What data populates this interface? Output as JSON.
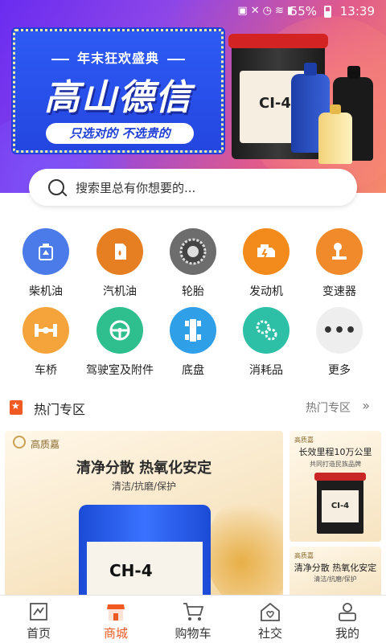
{
  "status_bar": {
    "battery_text": "55%",
    "time": "13:39"
  },
  "banner": {
    "subtitle": "年末狂欢盛典",
    "title": "高山德信",
    "tagline": "只选对的 不选贵的",
    "product_label": "CI-4"
  },
  "search": {
    "placeholder": "搜索里总有你想要的..."
  },
  "categories": [
    {
      "label": "柴机油",
      "icon": "oil-can-icon",
      "color": "#4a7be8"
    },
    {
      "label": "汽机油",
      "icon": "fuel-can-icon",
      "color": "#e67e22"
    },
    {
      "label": "轮胎",
      "icon": "tire-icon",
      "color": "#6d6d6d"
    },
    {
      "label": "发动机",
      "icon": "engine-icon",
      "color": "#f28b1c"
    },
    {
      "label": "变速器",
      "icon": "gear-shift-icon",
      "color": "#f08a2a"
    },
    {
      "label": "车桥",
      "icon": "axle-icon",
      "color": "#f4a43a"
    },
    {
      "label": "驾驶室及附件",
      "icon": "steering-wheel-icon",
      "color": "#2fbf8f"
    },
    {
      "label": "底盘",
      "icon": "chassis-icon",
      "color": "#2f9fe8"
    },
    {
      "label": "消耗品",
      "icon": "cog-icon",
      "color": "#2ec0a6"
    },
    {
      "label": "更多",
      "icon": "more-icon",
      "color": "#eeeeee"
    }
  ],
  "section": {
    "title": "热门专区",
    "more": "热门专区"
  },
  "cards": {
    "main": {
      "brand": "高质嘉",
      "headline": "清净分散 热氧化安定",
      "sub": "清洁/抗磨/保护",
      "product": "CH-4"
    },
    "side1": {
      "brand": "高质嘉",
      "headline": "长效里程10万公里",
      "sub": "共同打造民族品牌",
      "product": "CI-4"
    },
    "side2": {
      "brand": "高质嘉",
      "headline": "清净分散 热氧化安定",
      "sub": "清洁/抗磨/保护"
    }
  },
  "nav": [
    {
      "label": "首页",
      "icon": "home-icon",
      "active": false
    },
    {
      "label": "商城",
      "icon": "store-icon",
      "active": true
    },
    {
      "label": "购物车",
      "icon": "cart-icon",
      "active": false
    },
    {
      "label": "社交",
      "icon": "social-icon",
      "active": false
    },
    {
      "label": "我的",
      "icon": "profile-icon",
      "active": false
    }
  ]
}
